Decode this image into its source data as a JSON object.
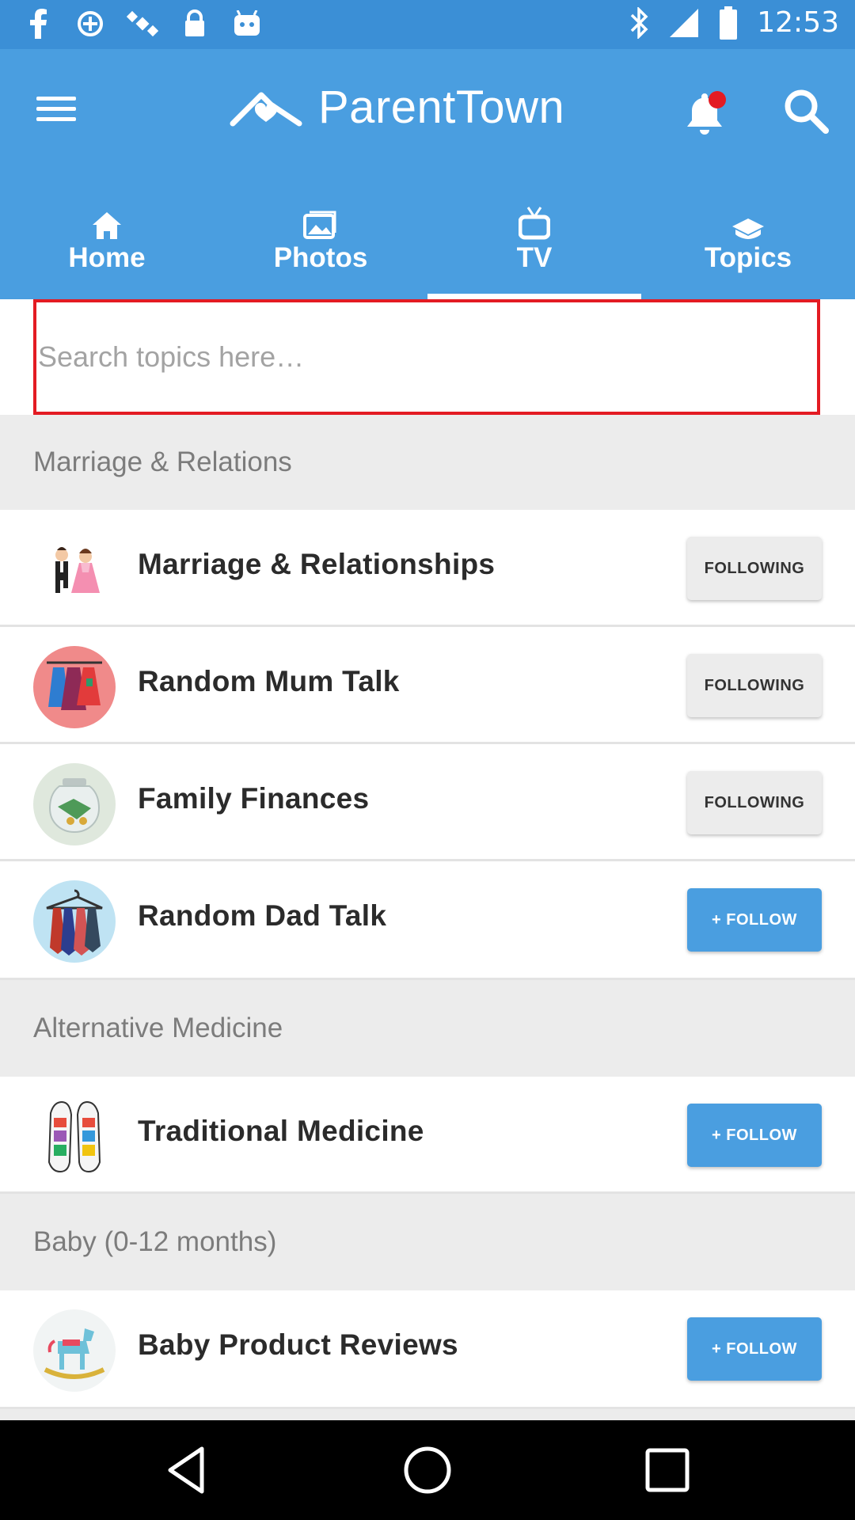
{
  "status_bar": {
    "time": "12:53",
    "left_icons": [
      "facebook-icon",
      "data-saver-icon",
      "satellite-icon",
      "lock-icon",
      "android-icon"
    ],
    "right_icons": [
      "bluetooth-icon",
      "signal-icon",
      "battery-icon"
    ]
  },
  "app_bar": {
    "brand_name": "ParentTown",
    "notification_dot_color": "#e31b23",
    "bar_color": "#4a9ee0"
  },
  "tabs": [
    {
      "label": "Home",
      "icon": "home-icon"
    },
    {
      "label": "Photos",
      "icon": "photos-icon"
    },
    {
      "label": "TV",
      "icon": "tv-icon",
      "active": true
    },
    {
      "label": "Topics",
      "icon": "topics-icon"
    }
  ],
  "search": {
    "placeholder": "Search topics here…",
    "value": ""
  },
  "sections": [
    {
      "header": "Marriage & Relations",
      "items": [
        {
          "title": "Marriage & Relationships",
          "button": "FOLLOWING",
          "avatar": "wedding-couple-avatar"
        },
        {
          "title": "Random Mum Talk",
          "button": "FOLLOWING",
          "avatar": "dresses-avatar"
        },
        {
          "title": "Family Finances",
          "button": "FOLLOWING",
          "avatar": "money-jar-avatar"
        },
        {
          "title": "Random Dad Talk",
          "button": "+ FOLLOW",
          "avatar": "ties-avatar"
        }
      ]
    },
    {
      "header": "Alternative Medicine",
      "items": [
        {
          "title": "Traditional Medicine",
          "button": "+ FOLLOW",
          "avatar": "reflexology-feet-avatar"
        }
      ]
    },
    {
      "header": "Baby (0-12 months)",
      "items": [
        {
          "title": "Baby Product Reviews",
          "button": "+ FOLLOW",
          "avatar": "rocking-horse-avatar"
        }
      ]
    }
  ],
  "nav_bar": [
    "back-icon",
    "home-circle-icon",
    "recents-icon"
  ]
}
